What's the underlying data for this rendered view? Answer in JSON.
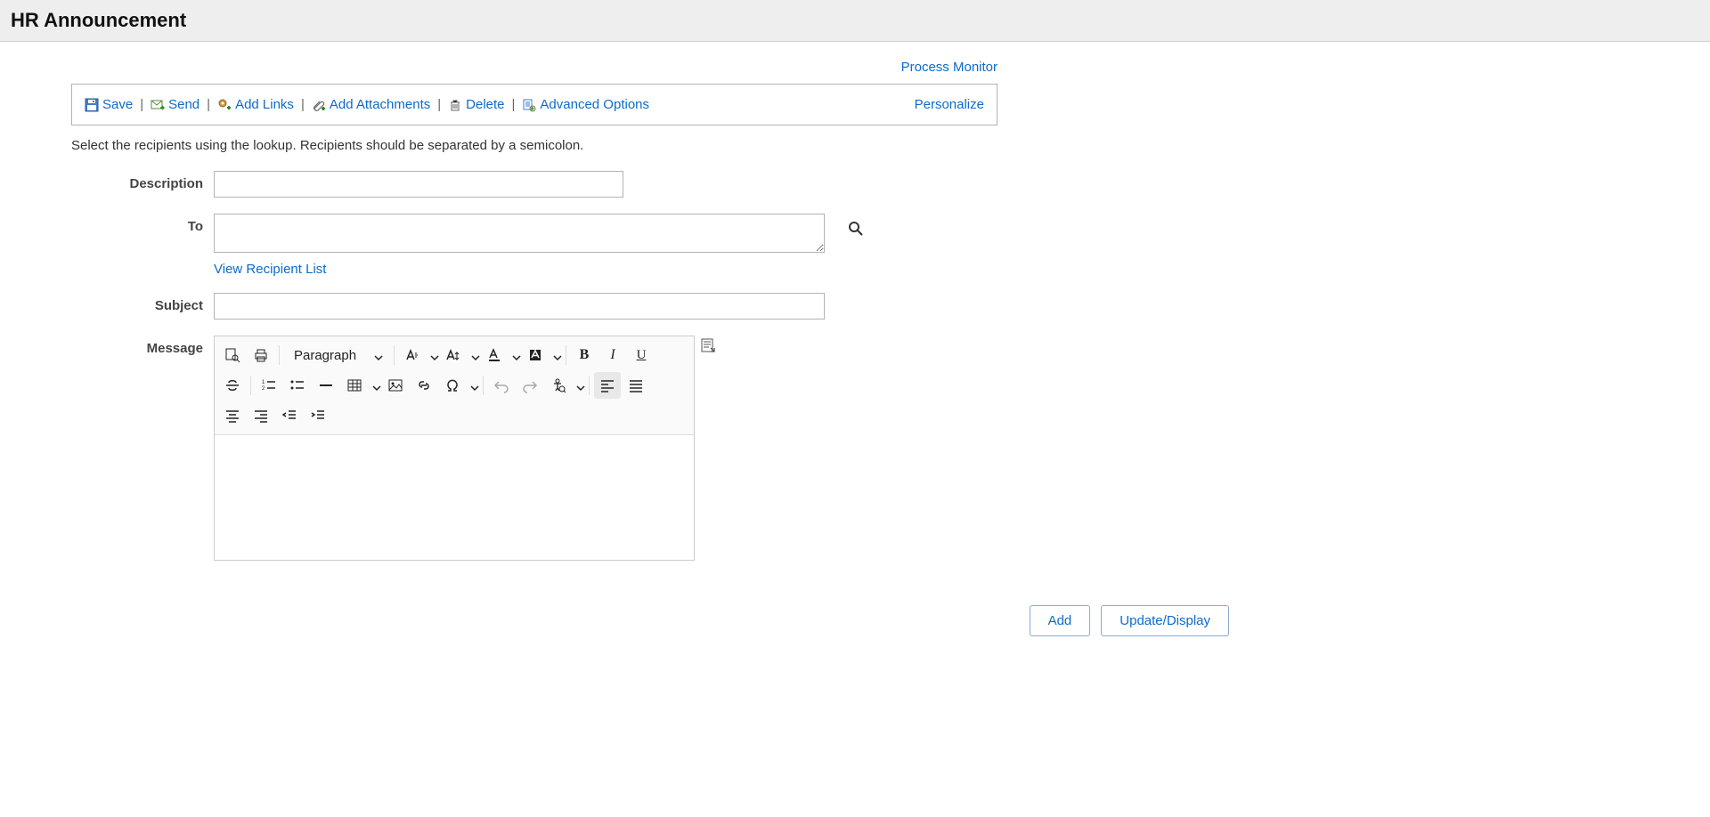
{
  "header": {
    "title": "HR Announcement"
  },
  "top_link": "Process Monitor",
  "toolbar": {
    "save": "Save",
    "send": "Send",
    "add_links": "Add Links",
    "add_attachments": "Add Attachments",
    "delete": "Delete",
    "advanced_options": "Advanced Options",
    "personalize": "Personalize"
  },
  "instruction": "Select the recipients using the lookup. Recipients should be separated by a semicolon.",
  "labels": {
    "description": "Description",
    "to": "To",
    "subject": "Subject",
    "message": "Message"
  },
  "fields": {
    "description": "",
    "to": "",
    "subject": ""
  },
  "links": {
    "view_recipient_list": "View Recipient List"
  },
  "editor": {
    "paragraph_label": "Paragraph"
  },
  "buttons": {
    "add": "Add",
    "update_display": "Update/Display"
  }
}
